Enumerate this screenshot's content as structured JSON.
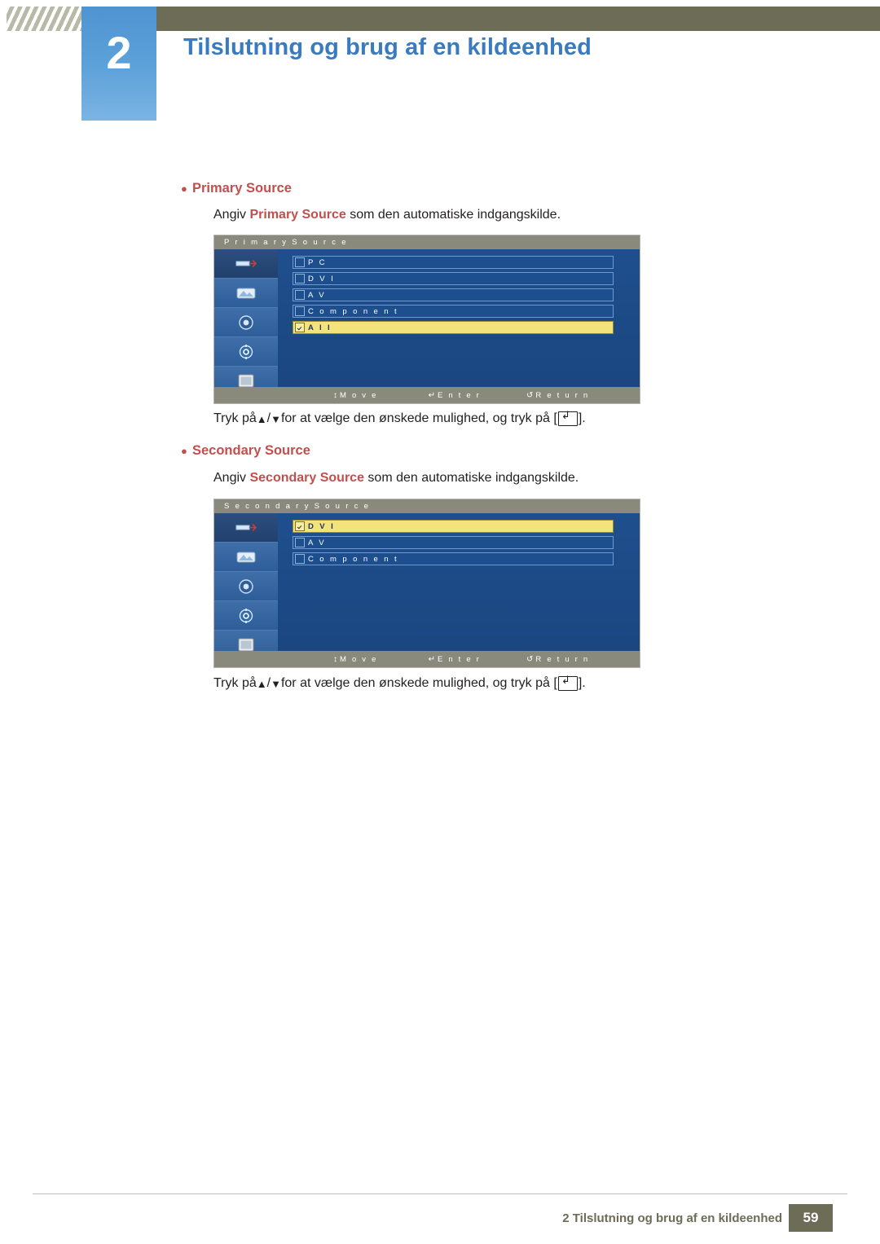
{
  "header": {
    "chapter_number": "2",
    "title": "Tilslutning og brug af en kildeenhed"
  },
  "sections": [
    {
      "bullet_label": "Primary Source",
      "description_prefix": "Angiv ",
      "description_highlight": "Primary Source",
      "description_suffix": " som den automatiske indgangskilde.",
      "osd": {
        "title": "P r i m a r y   S o u r c e",
        "items": [
          {
            "label": "P C",
            "checked": false,
            "selected": false
          },
          {
            "label": "D V I",
            "checked": false,
            "selected": false
          },
          {
            "label": "A V",
            "checked": false,
            "selected": false
          },
          {
            "label": "C o m p o n e n t",
            "checked": false,
            "selected": false
          },
          {
            "label": "A l l",
            "checked": true,
            "selected": true
          }
        ],
        "footer": [
          {
            "glyph": "↕",
            "label": "M o v e"
          },
          {
            "glyph": "↵",
            "label": "E n t e r"
          },
          {
            "glyph": "↺",
            "label": "R e t u r n"
          }
        ],
        "sidebar_icons": [
          "input-source-icon",
          "picture-icon",
          "sound-icon",
          "setup-icon",
          "multi-control-icon"
        ],
        "selected_icon_index": 0
      },
      "press_prefix": "Tryk på ",
      "press_mid": " for at vælge den ønskede mulighed, og tryk på [",
      "press_suffix": "]."
    },
    {
      "bullet_label": "Secondary Source",
      "description_prefix": "Angiv ",
      "description_highlight": "Secondary Source",
      "description_suffix": " som den automatiske indgangskilde.",
      "osd": {
        "title": "S e c o n d a r y   S o u r c e",
        "items": [
          {
            "label": "D V I",
            "checked": true,
            "selected": true
          },
          {
            "label": "A V",
            "checked": false,
            "selected": false
          },
          {
            "label": "C o m p o n e n t",
            "checked": false,
            "selected": false
          }
        ],
        "footer": [
          {
            "glyph": "↕",
            "label": "M o v e"
          },
          {
            "glyph": "↵",
            "label": "E n t e r"
          },
          {
            "glyph": "↺",
            "label": "R e t u r n"
          }
        ],
        "sidebar_icons": [
          "input-source-icon",
          "picture-icon",
          "sound-icon",
          "setup-icon",
          "multi-control-icon"
        ],
        "selected_icon_index": 0
      },
      "press_prefix": "Tryk på ",
      "press_mid": " for at vælge den ønskede mulighed, og tryk på [",
      "press_suffix": "]."
    }
  ],
  "footer": {
    "text": "2 Tilslutning og brug af en kildeenhed",
    "page": "59"
  },
  "colors": {
    "accent_red": "#c0504d",
    "header_blue": "#3a7bbf",
    "chapter_blue": "#5b9bd5",
    "olive": "#6c6c57",
    "osd_blue": "#1b4a86",
    "osd_highlight": "#f2e47a"
  }
}
